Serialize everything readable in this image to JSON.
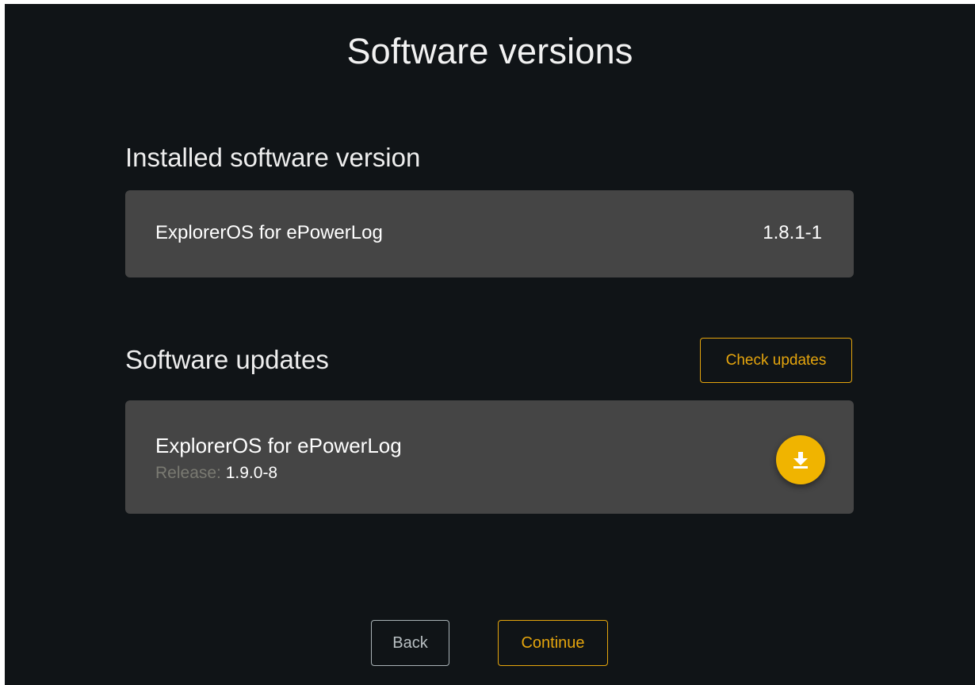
{
  "page": {
    "title": "Software versions"
  },
  "installed": {
    "section_title": "Installed software version",
    "app_name": "ExplorerOS for ePowerLog",
    "version": "1.8.1-1"
  },
  "updates": {
    "section_title": "Software updates",
    "check_button_label": "Check updates",
    "items": [
      {
        "app_name": "ExplorerOS for ePowerLog",
        "release_label": "Release:",
        "release_value": "1.9.0-8",
        "action_icon": "download-icon"
      }
    ]
  },
  "footer": {
    "back_label": "Back",
    "continue_label": "Continue"
  },
  "colors": {
    "background": "#101417",
    "card": "#454545",
    "accent": "#e5a50d",
    "download_button": "#f0b400"
  }
}
